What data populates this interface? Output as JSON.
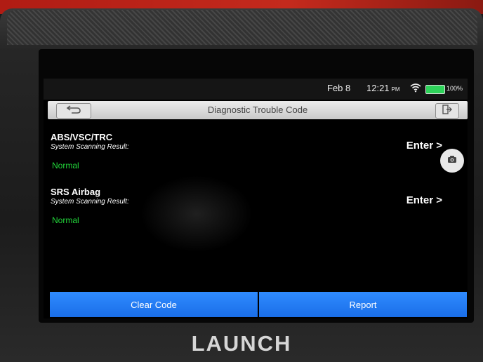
{
  "statusbar": {
    "date": "Feb 8",
    "time": "12:21",
    "ampm": "PM",
    "battery_percent": "100%",
    "battery_level": 1.0,
    "wifi_icon": "wifi-icon"
  },
  "header": {
    "title": "Diagnostic Trouble Code",
    "back_icon": "back-icon",
    "exit_icon": "exit-icon"
  },
  "systems": [
    {
      "name": "ABS/VSC/TRC",
      "result_label": "System Scanning Result:",
      "result": "Normal",
      "enter_label": "Enter >"
    },
    {
      "name": "SRS Airbag",
      "result_label": "System Scanning Result:",
      "result": "Normal",
      "enter_label": "Enter >"
    }
  ],
  "camera_icon": "camera-icon",
  "buttons": {
    "clear_code": "Clear Code",
    "report": "Report"
  },
  "brand": "LAUNCH",
  "colors": {
    "accent": "#1a6ee8",
    "normal": "#22d73a",
    "battery": "#2ed35a"
  }
}
